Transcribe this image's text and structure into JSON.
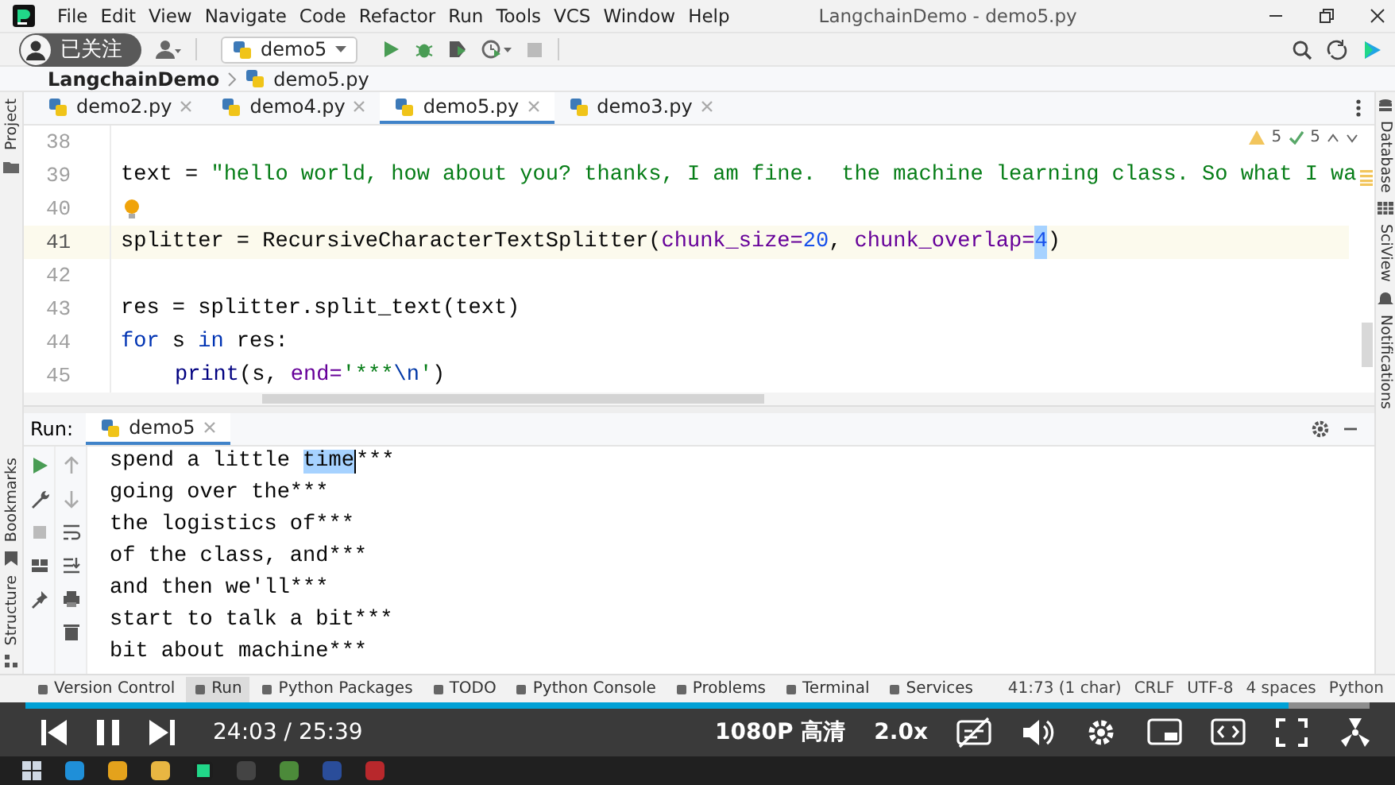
{
  "menu_bar": {
    "items": [
      "File",
      "Edit",
      "View",
      "Navigate",
      "Code",
      "Refactor",
      "Run",
      "Tools",
      "VCS",
      "Window",
      "Help"
    ],
    "title": "LangchainDemo - demo5.py"
  },
  "follow_button": {
    "label": "已关注"
  },
  "toolbar": {
    "run_config": "demo5"
  },
  "breadcrumb": [
    "LangchainDemo",
    "demo5.py"
  ],
  "left_strip": {
    "top": [
      "Project"
    ],
    "bottom": [
      "Bookmarks",
      "Structure"
    ]
  },
  "right_strip": [
    "Database",
    "SciView",
    "Notifications"
  ],
  "editor_tabs": [
    {
      "label": "demo2.py",
      "selected": false
    },
    {
      "label": "demo4.py",
      "selected": false
    },
    {
      "label": "demo5.py",
      "selected": true
    },
    {
      "label": "demo3.py",
      "selected": false
    }
  ],
  "inspections": {
    "warnings": "5",
    "checks": "5"
  },
  "editor": {
    "lines": [
      {
        "number": "38",
        "current": false,
        "bulb": false
      },
      {
        "number": "39",
        "current": false,
        "bulb": false,
        "segments": [
          {
            "kind": "plain",
            "text": "text = ",
            "selected": false
          },
          {
            "kind": "string",
            "text": "\"hello world, how about you? thanks, I am fine.  the machine learning class. So what I wa",
            "selected": false
          }
        ]
      },
      {
        "number": "40",
        "current": false,
        "bulb": true
      },
      {
        "number": "41",
        "current": true,
        "bulb": false,
        "segments": [
          {
            "kind": "plain",
            "text": "splitter = RecursiveCharacterTextSplitter(",
            "selected": false
          },
          {
            "kind": "param",
            "text": "chunk_size=",
            "selected": false
          },
          {
            "kind": "number",
            "text": "20",
            "selected": false
          },
          {
            "kind": "plain",
            "text": ", ",
            "selected": false
          },
          {
            "kind": "param",
            "text": "chunk_overlap=",
            "selected": false
          },
          {
            "kind": "number",
            "text": "4",
            "selected": true
          },
          {
            "kind": "plain",
            "text": ")",
            "selected": false
          }
        ]
      },
      {
        "number": "42",
        "current": false,
        "bulb": false
      },
      {
        "number": "43",
        "current": false,
        "bulb": false,
        "segments": [
          {
            "kind": "plain",
            "text": "res = splitter.split_text(text)",
            "selected": false
          }
        ]
      },
      {
        "number": "44",
        "current": false,
        "bulb": false,
        "segments": [
          {
            "kind": "keyword",
            "text": "for",
            "selected": false
          },
          {
            "kind": "plain",
            "text": " s ",
            "selected": false
          },
          {
            "kind": "keyword",
            "text": "in",
            "selected": false
          },
          {
            "kind": "plain",
            "text": " res:",
            "selected": false
          }
        ],
        "children": [
          {
            "number": "45",
            "current": false,
            "bulb": false,
            "segments": [
              {
                "kind": "builtin",
                "text": "print",
                "selected": false
              },
              {
                "kind": "plain",
                "text": "(s, ",
                "selected": false
              },
              {
                "kind": "param",
                "text": "end=",
                "selected": false
              },
              {
                "kind": "string",
                "text": "'***",
                "selected": false
              },
              {
                "kind": "escape",
                "text": "\\n",
                "selected": false
              },
              {
                "kind": "string",
                "text": "'",
                "selected": false
              },
              {
                "kind": "plain",
                "text": ")",
                "selected": false
              }
            ]
          }
        ]
      }
    ]
  },
  "run_panel": {
    "label": "Run:",
    "tabs": [
      {
        "label": "demo5",
        "selected": true
      }
    ],
    "output": [
      {
        "segments": [
          {
            "text": "spend a little ",
            "selected": false
          },
          {
            "text": "time",
            "selected": true
          },
          {
            "text": "***",
            "selected": false
          }
        ]
      },
      {
        "segments": [
          {
            "text": "going over the***",
            "selected": false
          }
        ]
      },
      {
        "segments": [
          {
            "text": "the logistics of***",
            "selected": false
          }
        ]
      },
      {
        "segments": [
          {
            "text": "of the class, and***",
            "selected": false
          }
        ]
      },
      {
        "segments": [
          {
            "text": "and then we'll***",
            "selected": false
          }
        ]
      },
      {
        "segments": [
          {
            "text": "start to talk a bit***",
            "selected": false
          }
        ]
      },
      {
        "segments": [
          {
            "text": "bit about machine***",
            "selected": false
          }
        ]
      }
    ]
  },
  "tool_windows": [
    {
      "label": "Version Control",
      "selected": false
    },
    {
      "label": "Run",
      "selected": true
    },
    {
      "label": "Python Packages",
      "selected": false
    },
    {
      "label": "TODO",
      "selected": false
    },
    {
      "label": "Python Console",
      "selected": false
    },
    {
      "label": "Problems",
      "selected": false
    },
    {
      "label": "Terminal",
      "selected": false
    },
    {
      "label": "Services",
      "selected": false
    }
  ],
  "status_bar": [
    "41:73 (1 char)",
    "CRLF",
    "UTF-8",
    "4 spaces",
    "Python"
  ],
  "player": {
    "level": 0.94,
    "playing": true,
    "time": "24:03 / 25:39",
    "quality": "1080P 高清",
    "speed": "2.0x"
  }
}
